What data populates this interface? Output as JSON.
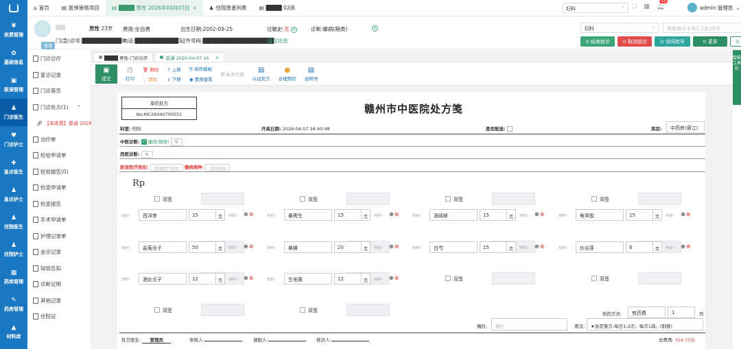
{
  "nav": [
    {
      "label": "收费管理",
      "icon": "¥"
    },
    {
      "label": "基础信息",
      "icon": "✿"
    },
    {
      "label": "医保管理",
      "icon": "▣"
    },
    {
      "label": "门诊医生",
      "icon": "♟",
      "active": true
    },
    {
      "label": "门诊护士",
      "icon": "♥"
    },
    {
      "label": "急诊医生",
      "icon": "✚"
    },
    {
      "label": "急诊护士",
      "icon": "♟"
    },
    {
      "label": "住院医生",
      "icon": "♟"
    },
    {
      "label": "住院护士",
      "icon": "♟"
    },
    {
      "label": "药库管理",
      "icon": "▦"
    },
    {
      "label": "药房管理",
      "icon": "✎"
    },
    {
      "label": "材料库",
      "icon": "▲"
    }
  ],
  "topbar": {
    "tabs": [
      {
        "label": "首页",
        "icon": "⌂"
      },
      {
        "label": "医保审核项目",
        "icon": "▤"
      },
      {
        "label": "████ 男性 2026年04月07日",
        "icon": "▤",
        "active": true
      },
      {
        "label": "住院患者列表",
        "icon": "♟"
      },
      {
        "label": "████ 02床",
        "icon": "▤"
      }
    ],
    "dept": "妇科",
    "notif_count": "13",
    "user": "admin 管理员"
  },
  "patient": {
    "sex": "男性",
    "age": "23岁",
    "fee_type_label": "费用:",
    "fee_type": "全自费",
    "dob_label": "出生日期:",
    "dob": "2002-09-25",
    "allergy_label": "过敏史:",
    "allergy": "无",
    "diag_label": "诊断:",
    "diag": "瘰病(期类)",
    "visit_label": "门(急)诊号:",
    "visit_no": "██████████0",
    "phone_label": "电话:",
    "phone": "███████████1",
    "id_label": "证件号码:",
    "id_no": "██████████████████",
    "infection": "疫试信息",
    "tag": "普通"
  },
  "right": {
    "dept": "妇科",
    "search_placeholder": "搜索就诊卡号/门(急)诊号",
    "buttons": [
      {
        "label": "结束就诊",
        "color": "#3aa676"
      },
      {
        "label": "取消就诊",
        "color": "#e24b4b"
      },
      {
        "label": "诊间挂号",
        "color": "#2fa5a0"
      },
      {
        "label": "更多",
        "color": "#2e8f66"
      },
      {
        "label": "患者列表",
        "color": "#ffffff"
      }
    ]
  },
  "sidebar": [
    {
      "label": "门诊诊疗"
    },
    {
      "label": "复诊记录"
    },
    {
      "label": "门诊首页"
    },
    {
      "label": "门诊处方(1)",
      "caret": "⌃"
    },
    {
      "label": "【未收费】普通 2026",
      "sub": true
    },
    {
      "label": "治疗单"
    },
    {
      "label": "检验申请单"
    },
    {
      "label": "检验报告(0)"
    },
    {
      "label": "检查申请单"
    },
    {
      "label": "检查报告"
    },
    {
      "label": "手术申请单"
    },
    {
      "label": "护理记录单"
    },
    {
      "label": "会诊记录"
    },
    {
      "label": "知情告知"
    },
    {
      "label": "诊断证明"
    },
    {
      "label": "其他记录"
    },
    {
      "label": "住院证"
    }
  ],
  "content_tabs": [
    {
      "label": "████ 男性-门诊诊疗"
    },
    {
      "label": "普通 2026-04-07 16",
      "active": true,
      "close": "×"
    }
  ],
  "toolbar": {
    "submit": "提交",
    "print": "打印",
    "delete": "删除",
    "clear": "清除",
    "up": "上移",
    "down": "下移",
    "save_template": "另存模板",
    "cost_view": "费用查看",
    "supplement": "补开代煎",
    "history_rx": "以往处方",
    "rational": "合理用药",
    "manual": "说明书"
  },
  "rx": {
    "type": "草药处方",
    "no": "No:MC26040700551",
    "title": "赣州市中医院处方笺",
    "dept_label": "科室:",
    "dept": "妇科",
    "open_label": "开具日期:",
    "open_date": "2026-04-07 16:40:48",
    "delivery_label": "是否配送:",
    "store_label": "库房:",
    "store": "中药房(蓉江)",
    "tcm_label": "中医诊断:",
    "tcm_diag": "瘰病(期类)",
    "west_label": "西医诊断:",
    "ins_label": "医保医疗类别:",
    "ins_placeholder": "医保医疗类别",
    "chronic_label": "慢病病种:",
    "chronic_placeholder": "慢病病种",
    "rp": "Rp",
    "double_sign": "双签",
    "proc_label": "炮制?",
    "special_label": "特殊?",
    "herbs": [
      {
        "name": "西洋参",
        "qty": "15",
        "unit": "克"
      },
      {
        "name": "桑寄生",
        "qty": "15",
        "unit": "克"
      },
      {
        "name": "酒续断",
        "qty": "15",
        "unit": "克"
      },
      {
        "name": "龟甲胶",
        "qty": "15",
        "unit": "克"
      },
      {
        "name": "盐菟丝子",
        "qty": "50",
        "unit": "克"
      },
      {
        "name": "桑椹",
        "qty": "20",
        "unit": "克"
      },
      {
        "name": "白芍",
        "qty": "15",
        "unit": "克"
      },
      {
        "name": "炒谷芽",
        "qty": "8",
        "unit": "克"
      },
      {
        "name": "酒女贞子",
        "qty": "12",
        "unit": "克"
      },
      {
        "name": "生地黄",
        "qty": "12",
        "unit": "克"
      }
    ],
    "decoct_label": "煎药方式:",
    "decoct": "煎药费",
    "doses": "1",
    "doses_unit": "剂",
    "note_label": "嘱托:",
    "note_placeholder": "嘱托",
    "usage_label": "用法:",
    "usage": "★协定膏方-每日1-2次，每次1袋。(制膏)",
    "doctor_label": "处方医生:",
    "doctor": "管理员",
    "review_label": "审核人:",
    "dispense_label": "调配人:",
    "check_label": "核对人:",
    "total_label": "总费用:",
    "total": "324.75元"
  },
  "right_panel": "智能工具栏"
}
